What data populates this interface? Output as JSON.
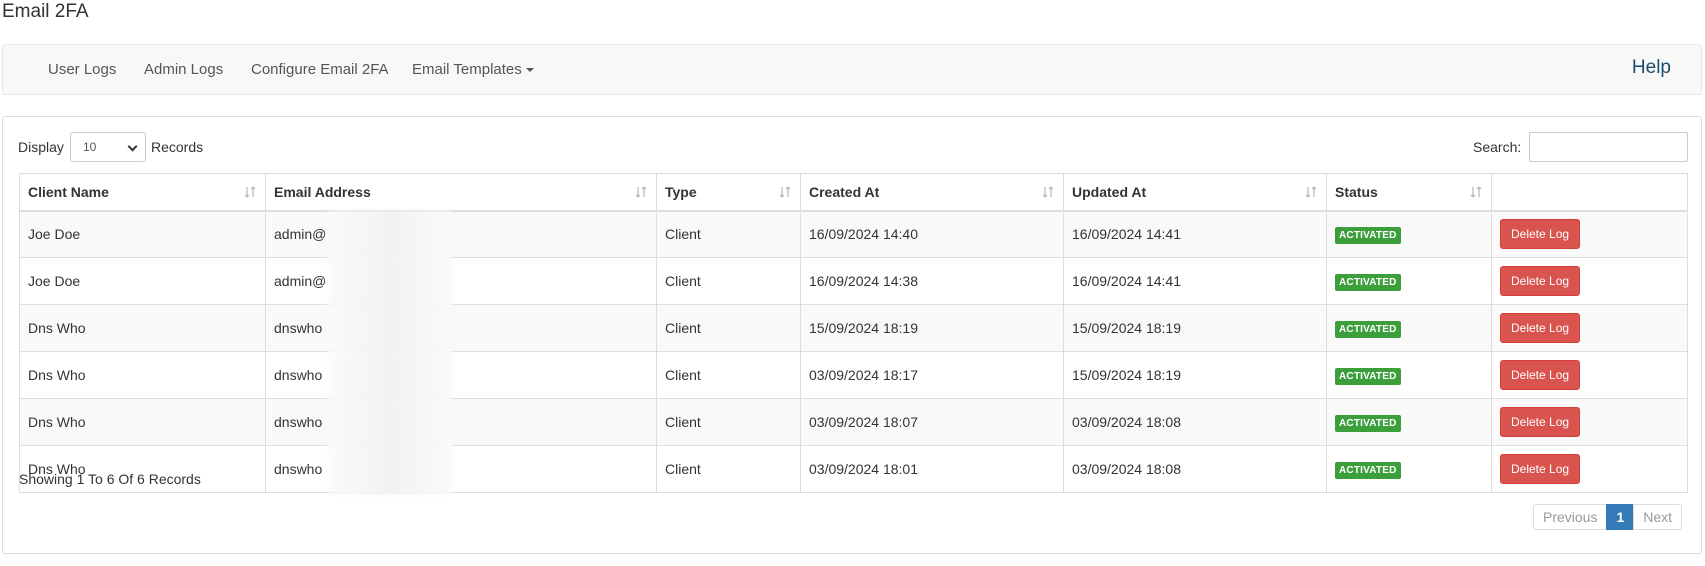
{
  "page": {
    "title": "Email 2FA"
  },
  "nav": {
    "items": [
      {
        "label": "User Logs"
      },
      {
        "label": "Admin Logs"
      },
      {
        "label": "Configure Email 2FA"
      },
      {
        "label": "Email Templates"
      }
    ],
    "help": "Help"
  },
  "controls": {
    "display_label": "Display",
    "display_value": "10",
    "records_label": "Records",
    "search_label": "Search:",
    "search_value": ""
  },
  "table": {
    "columns": [
      "Client Name",
      "Email Address",
      "Type",
      "Created At",
      "Updated At",
      "Status",
      ""
    ],
    "rows": [
      {
        "client": "Joe Doe",
        "email": "admin@",
        "type": "Client",
        "created": "16/09/2024 14:40",
        "updated": "16/09/2024 14:41",
        "status": "ACTIVATED",
        "action": "Delete Log"
      },
      {
        "client": "Joe Doe",
        "email": "admin@",
        "type": "Client",
        "created": "16/09/2024 14:38",
        "updated": "16/09/2024 14:41",
        "status": "ACTIVATED",
        "action": "Delete Log"
      },
      {
        "client": "Dns Who",
        "email": "dnswho",
        "type": "Client",
        "created": "15/09/2024 18:19",
        "updated": "15/09/2024 18:19",
        "status": "ACTIVATED",
        "action": "Delete Log"
      },
      {
        "client": "Dns Who",
        "email": "dnswho",
        "type": "Client",
        "created": "03/09/2024 18:17",
        "updated": "15/09/2024 18:19",
        "status": "ACTIVATED",
        "action": "Delete Log"
      },
      {
        "client": "Dns Who",
        "email": "dnswho",
        "type": "Client",
        "created": "03/09/2024 18:07",
        "updated": "03/09/2024 18:08",
        "status": "ACTIVATED",
        "action": "Delete Log"
      },
      {
        "client": "Dns Who",
        "email": "dnswho",
        "type": "Client",
        "created": "03/09/2024 18:01",
        "updated": "03/09/2024 18:08",
        "status": "ACTIVATED",
        "action": "Delete Log"
      }
    ]
  },
  "footer": {
    "showing": "Showing 1 To 6 Of 6 Records",
    "pagination": {
      "previous": "Previous",
      "current": "1",
      "next": "Next"
    }
  },
  "colors": {
    "status_green": "#3c9f3c",
    "danger_red": "#d9534f",
    "active_page_blue": "#337ab7",
    "help_link": "#1a4d6e"
  },
  "icons": {
    "sort": "sort-arrows-icon",
    "dropdown": "caret-down-icon"
  }
}
